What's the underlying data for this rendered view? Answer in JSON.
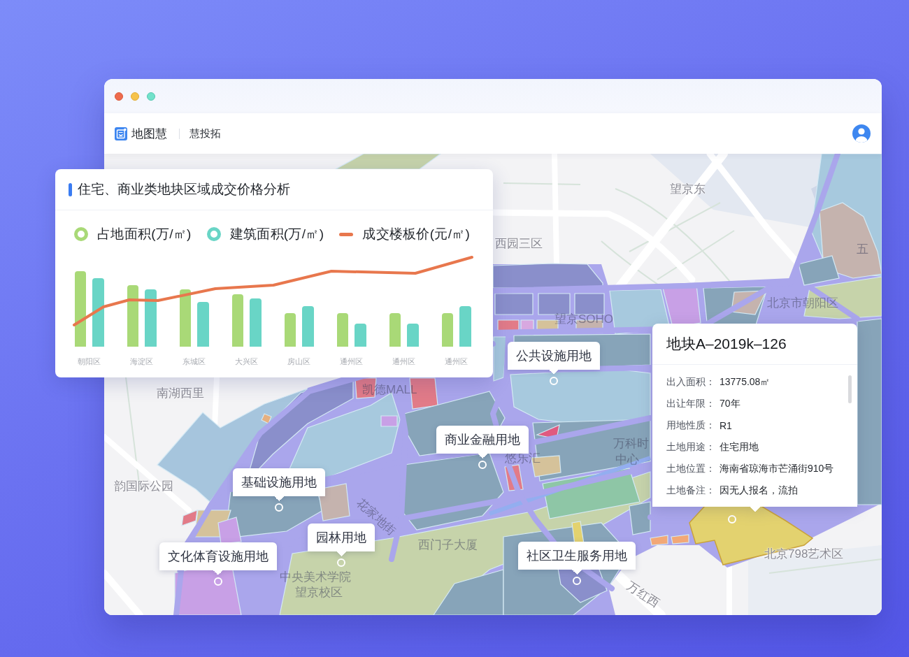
{
  "window": {
    "app_name": "地图慧",
    "module": "慧投拓"
  },
  "chart_panel": {
    "title": "住宅、商业类地块区域成交价格分析",
    "legend": [
      {
        "label": "占地面积(万/㎡)",
        "kind": "ring",
        "color": "#a9d977"
      },
      {
        "label": "建筑面积(万/㎡)",
        "kind": "ring",
        "color": "#69d5c6"
      },
      {
        "label": "成交楼板价(元/㎡)",
        "kind": "line",
        "color": "#e8774d"
      }
    ],
    "x_labels": [
      "朝阳区",
      "海淀区",
      "东城区",
      "大兴区",
      "房山区",
      "通州区",
      "通州区",
      "通州区"
    ]
  },
  "map": {
    "place_names": [
      "西园三区",
      "望京东",
      "五",
      "北京市朝阳区",
      "望京SOHO",
      "南湖西里",
      "凯德MALL",
      "韵国际公园",
      "万科时",
      "中心",
      "悠乐汇",
      "花家地街",
      "西门子大厦",
      "中央美术学院",
      "望京校区",
      "北京798艺术区",
      "万红西"
    ],
    "parcel_labels": [
      "公共设施用地",
      "商业金融用地",
      "基础设施用地",
      "园林用地",
      "文化体育设施用地",
      "社区卫生服务用地"
    ]
  },
  "parcel_info": {
    "title": "地块A–2019k–126",
    "fields": [
      {
        "label": "出入面积：",
        "value": "13775.08㎡"
      },
      {
        "label": "出让年限：",
        "value": "70年"
      },
      {
        "label": "用地性质：",
        "value": "R1"
      },
      {
        "label": "土地用途：",
        "value": "住宅用地"
      },
      {
        "label": "土地位置：",
        "value": "海南省琼海市芒涌街910号"
      },
      {
        "label": "土地备注：",
        "value": "因无人报名，流拍"
      }
    ]
  }
}
